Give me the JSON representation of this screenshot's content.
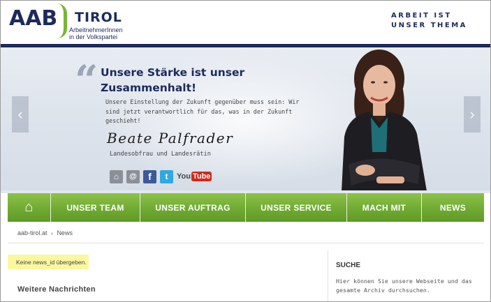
{
  "header": {
    "logo_aab": "AAB",
    "logo_tirol": "TIROL",
    "logo_sub_line1": "ArbeitnehmerInnen",
    "logo_sub_line2": "in der Volkspartei",
    "tagline_line1": "ARBEIT IST",
    "tagline_line2": "UNSER THEMA"
  },
  "hero": {
    "quote_mark": "“",
    "title": "Unsere Stärke ist unser Zusammenhalt!",
    "text": "Unsere Einstellung der Zukunft gegenüber muss sein: Wir sind jetzt verantwortlich für das, was in der Zukunft geschieht!",
    "signature": "Beate Palfrader",
    "role": "Landesobfrau und Landesrätin",
    "prev_arrow": "‹",
    "next_arrow": "›",
    "social": {
      "home_glyph": "⌂",
      "mail_glyph": "@",
      "facebook_glyph": "f",
      "twitter_glyph": "t",
      "youtube_you": "You",
      "youtube_tube": "Tube"
    }
  },
  "nav": {
    "home_glyph": "⌂",
    "items": [
      "UNSER TEAM",
      "UNSER AUFTRAG",
      "UNSER SERVICE",
      "MACH MIT",
      "NEWS"
    ]
  },
  "breadcrumb": {
    "home": "aab-tirol.at",
    "separator": "»",
    "current": "News"
  },
  "main": {
    "notice": "Keine news_id übergeben.",
    "more_news_title": "Weitere Nachrichten"
  },
  "sidebar": {
    "search_title": "SUCHE",
    "search_text": "Hier können Sie unsere Webseite und das gesamte Archiv durchsuchen."
  },
  "colors": {
    "brand_navy": "#1d2a5c",
    "brand_green": "#7ab534",
    "notice_yellow": "#fbf79f"
  }
}
